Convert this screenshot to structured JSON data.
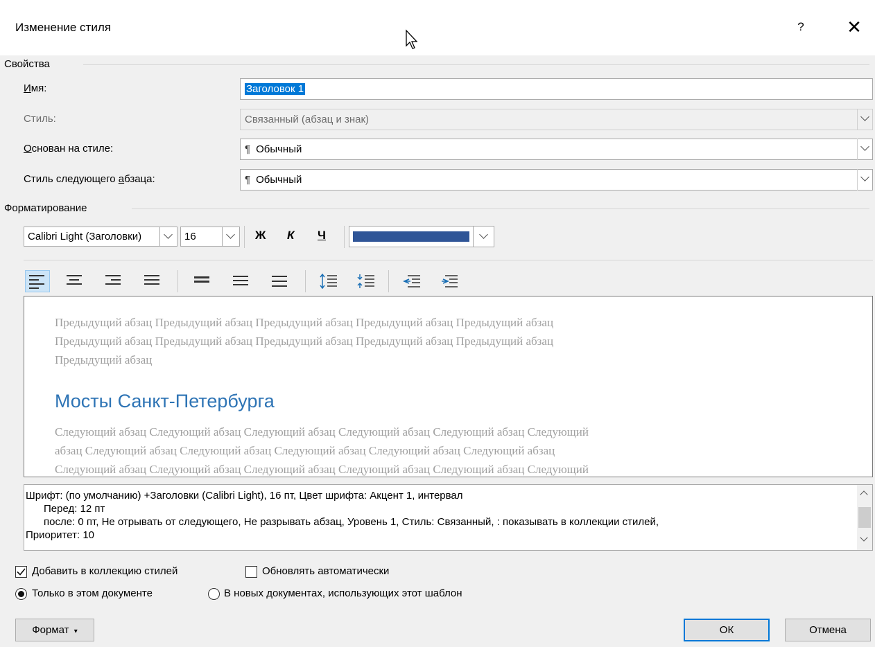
{
  "dialog": {
    "title": "Изменение стиля",
    "help": "?",
    "close": "✕"
  },
  "properties": {
    "section_title": "Свойства",
    "name_label": "Имя:",
    "name_value": "Заголовок 1",
    "style_type_label": "Стиль:",
    "style_type_value": "Связанный (абзац и знак)",
    "based_on_label": "Основан на стиле:",
    "based_on_value": "Обычный",
    "next_style_label": "Стиль следующего абзаца:",
    "next_style_value": "Обычный",
    "pilcrow": "¶"
  },
  "formatting": {
    "section_title": "Форматирование",
    "font_name": "Calibri Light (Заголовки)",
    "font_size": "16",
    "bold": "Ж",
    "italic": "К",
    "underline": "Ч",
    "font_color": "#2f5597"
  },
  "preview": {
    "previous_paragraph": [
      "Предыдущий абзац Предыдущий абзац Предыдущий абзац Предыдущий абзац Предыдущий абзац",
      "Предыдущий абзац Предыдущий абзац Предыдущий абзац Предыдущий абзац Предыдущий абзац",
      "Предыдущий абзац"
    ],
    "heading": "Мосты Санкт-Петербурга",
    "next_paragraph": [
      "Следующий абзац Следующий абзац Следующий абзац Следующий абзац Следующий абзац Следующий",
      "абзац Следующий абзац Следующий абзац Следующий абзац Следующий абзац Следующий абзац",
      "Следующий абзац Следующий абзац Следующий абзац Следующий абзац Следующий абзац Следующий"
    ]
  },
  "description": {
    "line1": "Шрифт: (по умолчанию) +Заголовки (Calibri Light), 16 пт, Цвет шрифта: Акцент 1, интервал",
    "line2": "Перед:  12 пт",
    "line3": "после: 0 пт, Не отрывать от следующего, Не разрывать абзац, Уровень 1, Стиль: Связанный, : показывать в коллекции стилей,",
    "line4": "Приоритет: 10"
  },
  "options": {
    "add_to_gallery": "Добавить в коллекцию стилей",
    "add_to_gallery_checked": true,
    "auto_update": "Обновлять автоматически",
    "auto_update_checked": false,
    "only_this_doc": "Только в этом документе",
    "new_docs": "В новых документах, использующих этот шаблон",
    "selected_scope": "only_this_doc"
  },
  "buttons": {
    "format": "Формат",
    "ok": "ОК",
    "cancel": "Отмена"
  }
}
